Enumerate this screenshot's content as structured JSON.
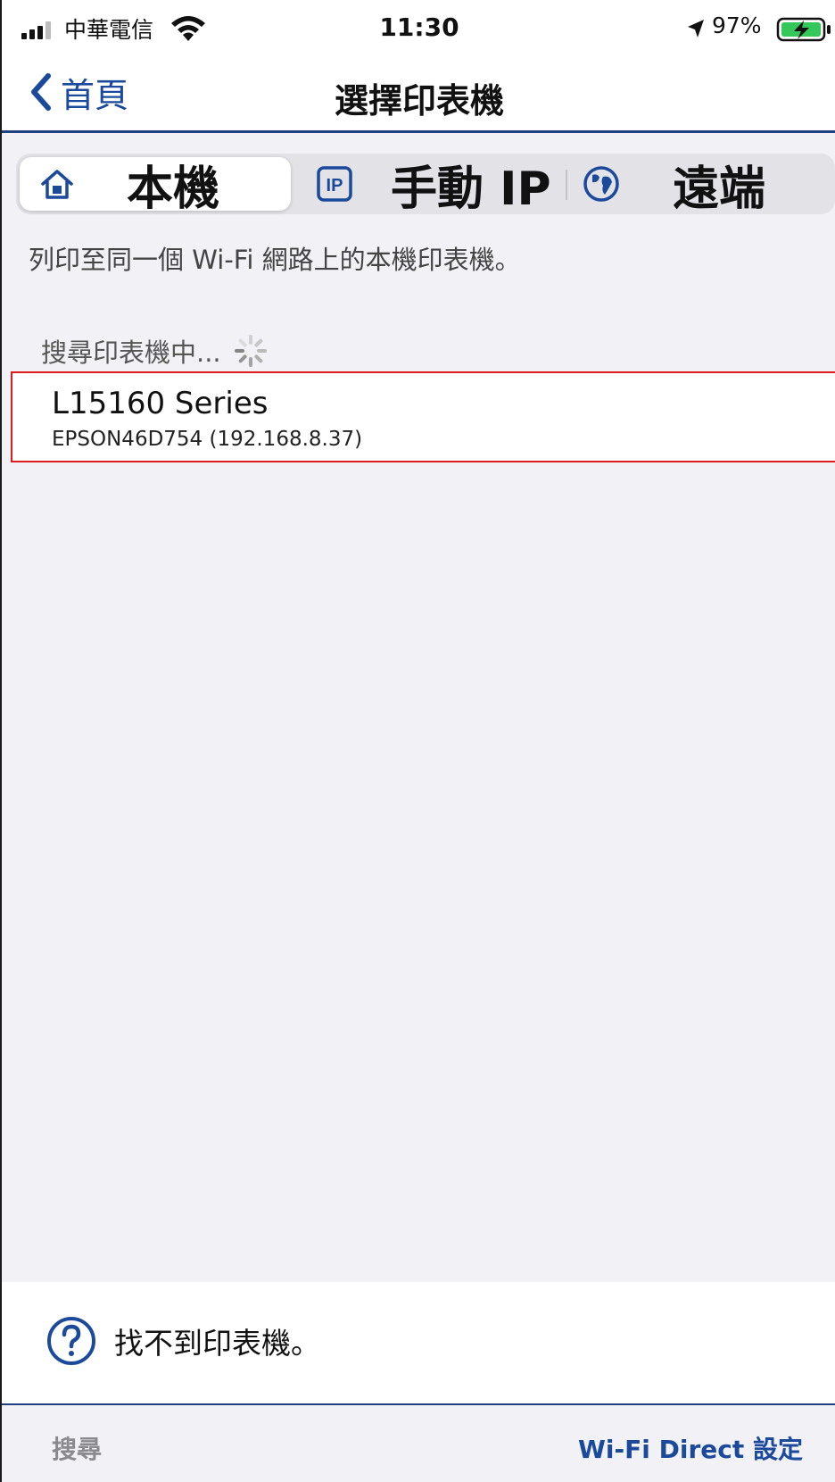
{
  "status_bar": {
    "carrier": "中華電信",
    "time": "11:30",
    "battery_percent": "97%"
  },
  "nav": {
    "back_label": "首頁",
    "title": "選擇印表機"
  },
  "segments": [
    {
      "label": "本機",
      "icon": "home-icon",
      "selected": true
    },
    {
      "label": "手動 IP",
      "icon": "ip-icon",
      "selected": false
    },
    {
      "label": "遠端",
      "icon": "globe-icon",
      "selected": false
    }
  ],
  "description": "列印至同一個 Wi-Fi 網路上的本機印表機。",
  "searching_label": "搜尋印表機中...",
  "printers": [
    {
      "name": "L15160 Series",
      "address": "EPSON46D754 (192.168.8.37)"
    }
  ],
  "help": {
    "label": "找不到印表機。",
    "icon": "question-circle-icon"
  },
  "toolbar": {
    "search_label": "搜尋",
    "wifi_direct_label": "Wi-Fi Direct 設定"
  },
  "colors": {
    "accent": "#1b4a9c",
    "selection_border": "#e01b1b",
    "background": "#f1f1f6"
  }
}
